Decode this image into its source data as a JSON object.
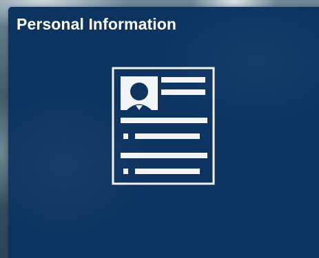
{
  "tile": {
    "title": "Personal Information",
    "icon": "personal-info-document-icon"
  },
  "colors": {
    "tile_background": "#0d3461",
    "icon_stroke": "#ffffff",
    "title_text": "#ffffff"
  }
}
